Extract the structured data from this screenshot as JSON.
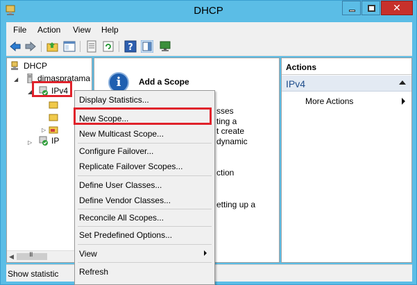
{
  "window": {
    "title": "DHCP"
  },
  "menubar": {
    "items": [
      "File",
      "Action",
      "View",
      "Help"
    ]
  },
  "tree": {
    "root": "DHCP",
    "server": "dimaspratama",
    "ipv4": "IPv4",
    "ipv6_fragment": "IP"
  },
  "center": {
    "title": "Add a Scope",
    "fragments": [
      "sses",
      "ting a",
      "t create",
      "dynamic",
      "ction",
      "etting up a"
    ]
  },
  "actions": {
    "header": "Actions",
    "section": "IPv4",
    "more": "More Actions"
  },
  "context_menu": {
    "items": [
      "Display Statistics...",
      "New Scope...",
      "New Multicast Scope...",
      "Configure Failover...",
      "Replicate Failover Scopes...",
      "Define User Classes...",
      "Define Vendor Classes...",
      "Reconcile All Scopes...",
      "Set Predefined Options...",
      "View",
      "Refresh"
    ]
  },
  "scrollbar": {
    "grip": "III"
  },
  "status": {
    "text": "Show statistic"
  },
  "colors": {
    "highlight": "#e0222b",
    "titlebar": "#5bbde6",
    "close": "#c7312b"
  }
}
